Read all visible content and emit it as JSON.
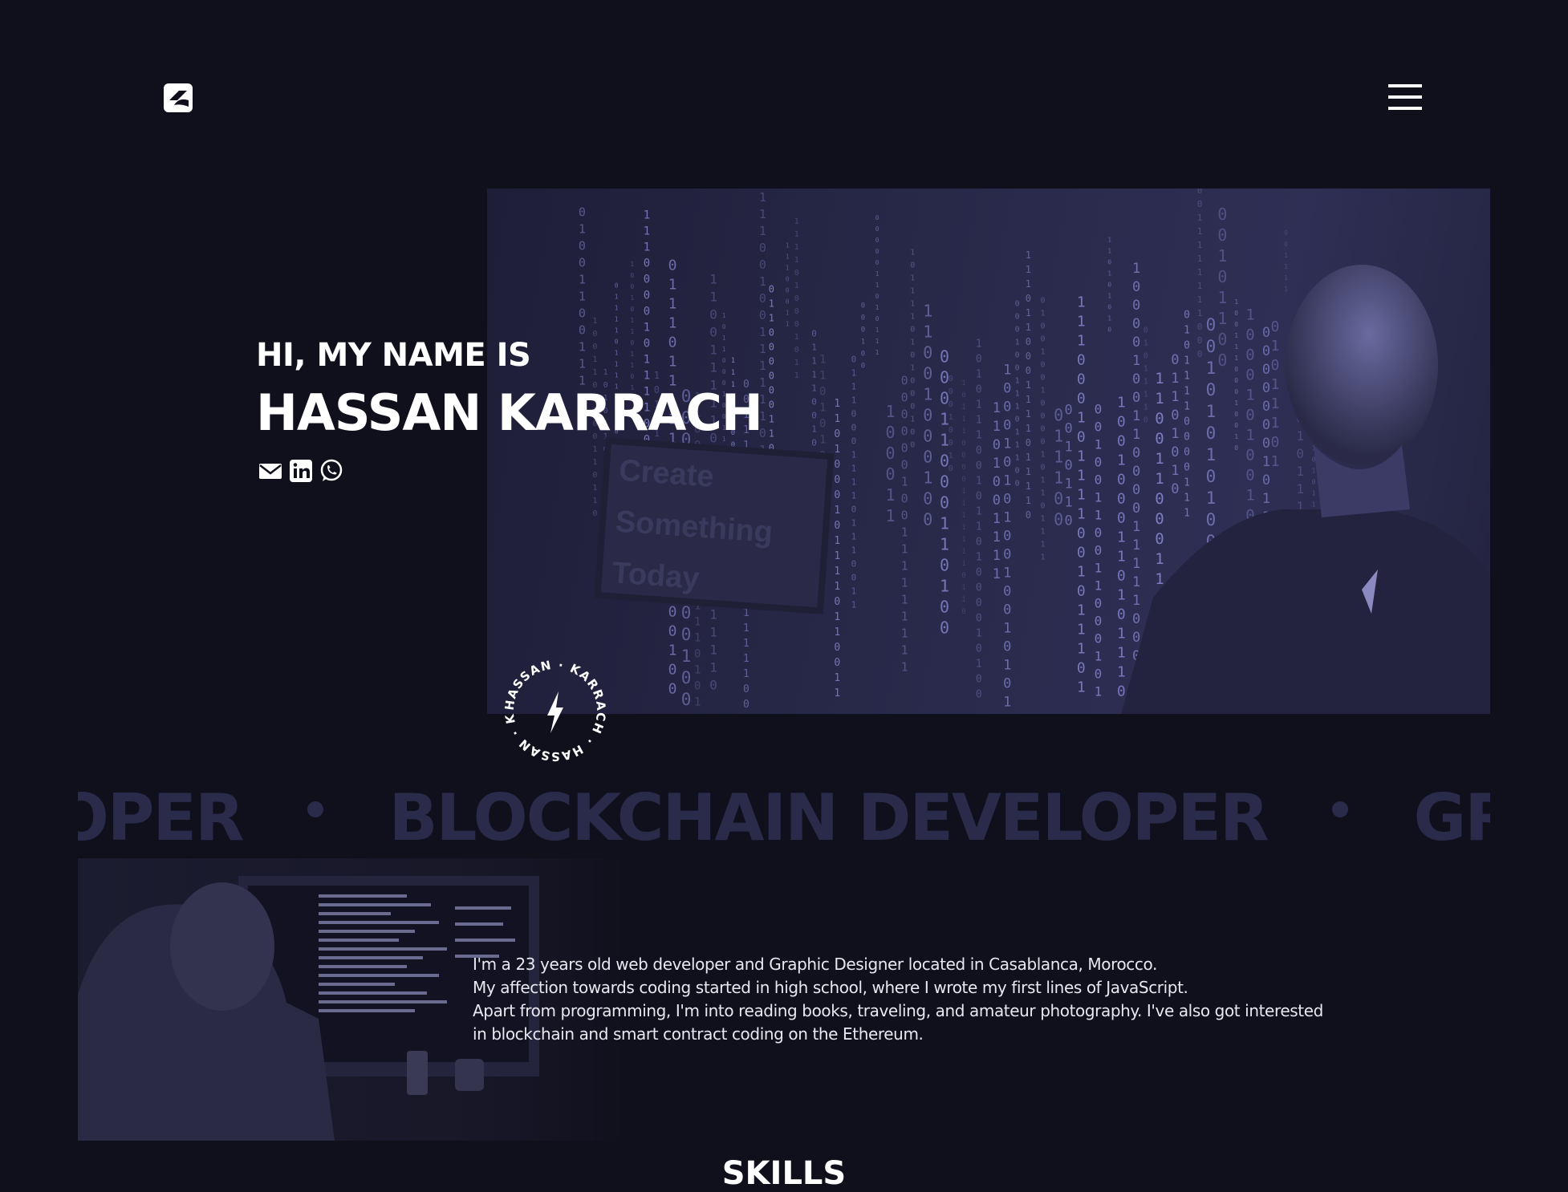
{
  "header": {
    "logo_icon": "brand-logo-icon",
    "menu_icon": "hamburger-menu-icon"
  },
  "hero": {
    "greeting": "HI, MY NAME IS",
    "name": "HASSAN KARRACH",
    "monitor_text": [
      "Create",
      "Something",
      "Today"
    ],
    "socials": [
      {
        "icon": "email-icon"
      },
      {
        "icon": "linkedin-icon"
      },
      {
        "icon": "whatsapp-icon"
      }
    ],
    "badge_text": "HASSAN · KARRACH · HASSAN · KARRACH ·",
    "badge_icon": "lightning-icon"
  },
  "marquee": {
    "partial_start": "VELOPER",
    "middle": "BLOCKCHAIN DEVELOPER",
    "partial_end": "GRAPH"
  },
  "about": {
    "paragraphs": [
      "I'm a 23 years old web developer and Graphic Designer located in Casablanca, Morocco.",
      "My affection towards coding started in high school, where I wrote my first lines of JavaScript.",
      "Apart from programming, I'm into reading books, traveling, and amateur photography. I've also got interested in blockchain and smart contract coding on the Ethereum."
    ]
  },
  "skills": {
    "title": "SKILLS"
  },
  "colors": {
    "background": "#10101d",
    "hero_tint": "#2b2b4e",
    "marquee": "#2a2a4a",
    "text": "#ffffff"
  }
}
